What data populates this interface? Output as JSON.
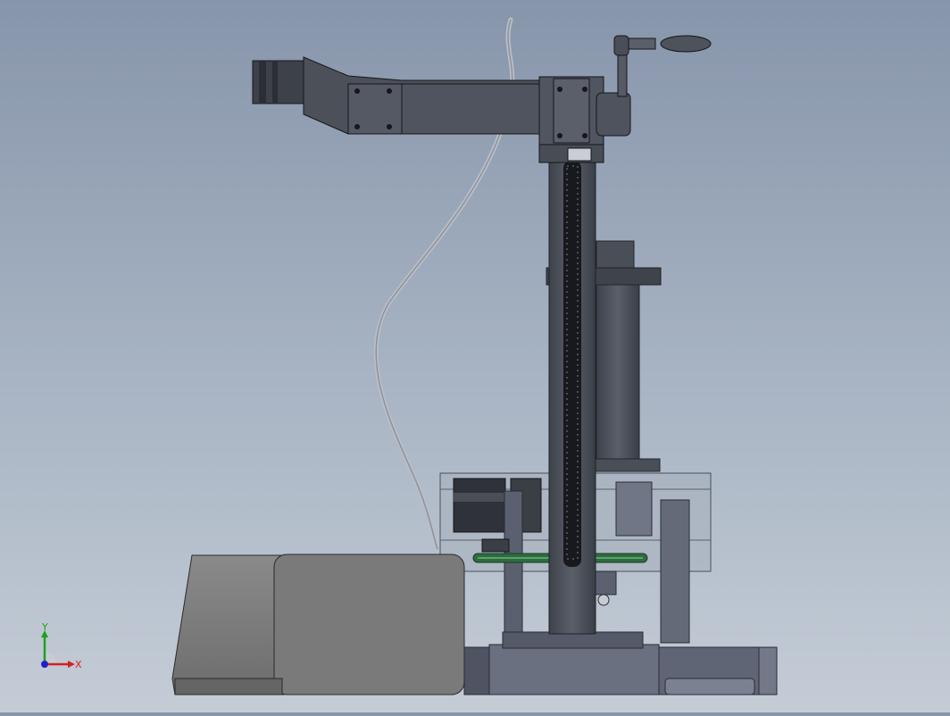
{
  "viewport": {
    "background_top": "#8795ab",
    "background_bottom": "#c4ccd6"
  },
  "model": {
    "parts": [
      "stepper-motor",
      "upper-arm",
      "hand-crank",
      "cable",
      "rack-column",
      "spindle-housing",
      "base-frame",
      "control-box",
      "drive-assembly"
    ]
  },
  "axis_triad": {
    "x_label": "X",
    "y_label": "Y",
    "x_color": "#d42020",
    "y_color": "#1fa01f",
    "z_color": "#2020c8"
  }
}
